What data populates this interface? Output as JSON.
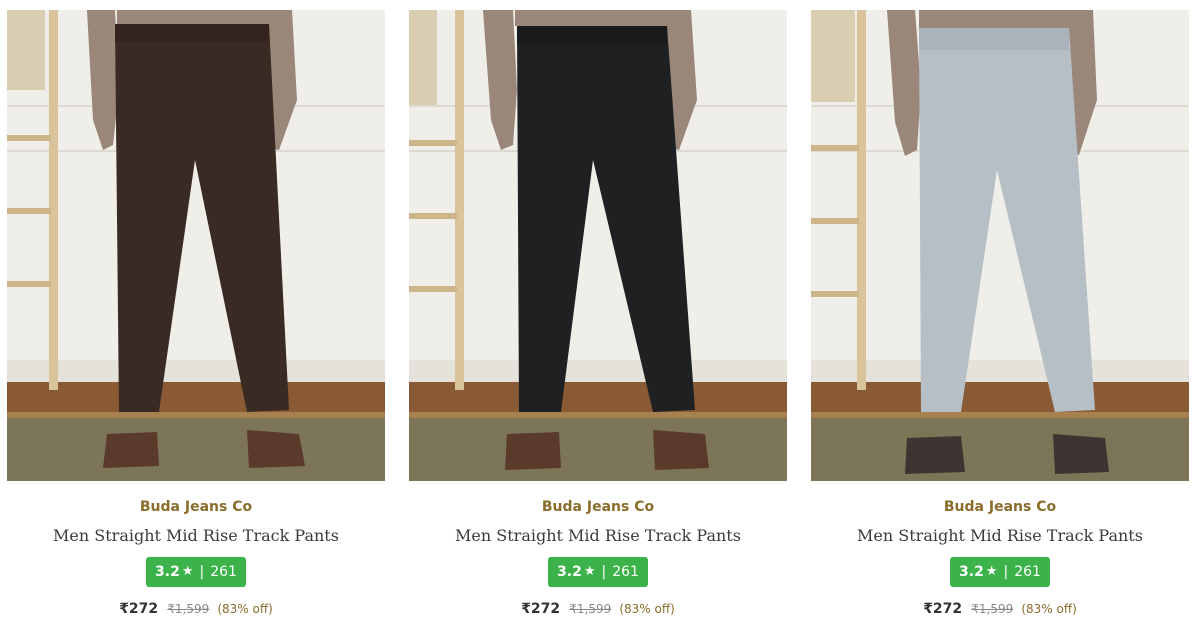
{
  "products": [
    {
      "brand": "Buda Jeans Co",
      "title": "Men Straight Mid Rise Track Pants",
      "rating": "3.2",
      "star_icon": "star-icon",
      "rating_separator": "|",
      "reviews": "261",
      "price": "₹272",
      "mrp": "₹1,599",
      "discount": "(83% off)",
      "image": {
        "subject": "model-wearing-pants",
        "pants_color": "#3a2a24",
        "rating_color": "#3bb34a"
      }
    },
    {
      "brand": "Buda Jeans Co",
      "title": "Men Straight Mid Rise Track Pants",
      "rating": "3.2",
      "star_icon": "star-icon",
      "rating_separator": "|",
      "reviews": "261",
      "price": "₹272",
      "mrp": "₹1,599",
      "discount": "(83% off)",
      "image": {
        "subject": "model-wearing-pants",
        "pants_color": "#1f2022",
        "rating_color": "#3bb34a"
      }
    },
    {
      "brand": "Buda Jeans Co",
      "title": "Men Straight Mid Rise Track Pants",
      "rating": "3.2",
      "star_icon": "star-icon",
      "rating_separator": "|",
      "reviews": "261",
      "price": "₹272",
      "mrp": "₹1,599",
      "discount": "(83% off)",
      "image": {
        "subject": "model-wearing-pants",
        "pants_color": "#b6bfc6",
        "rating_color": "#3bb34a"
      }
    }
  ]
}
